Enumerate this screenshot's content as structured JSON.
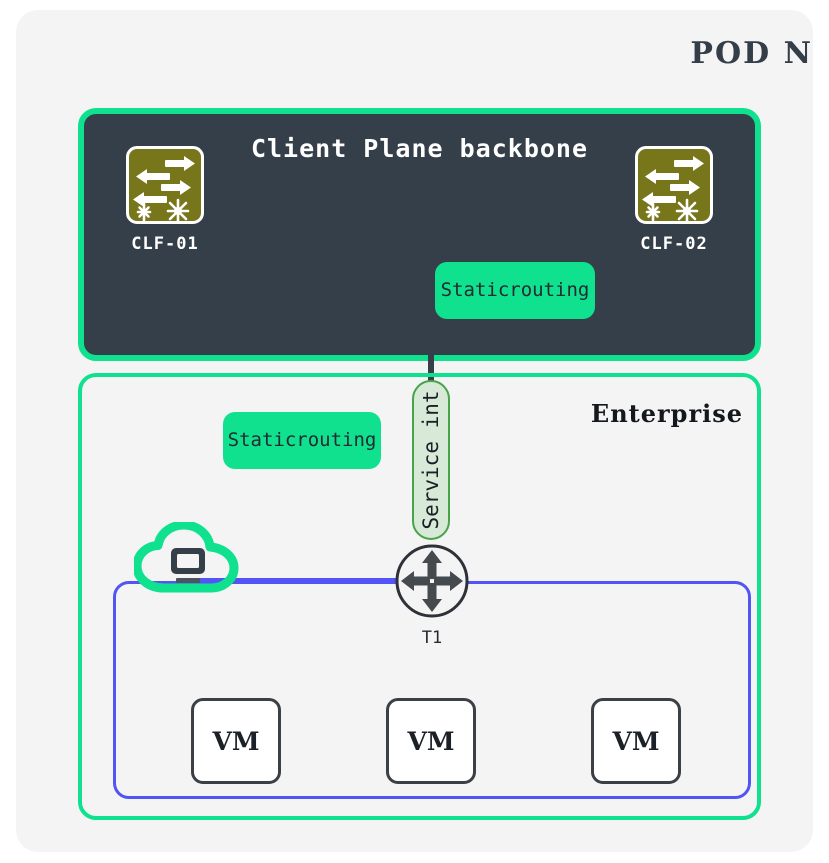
{
  "pod": {
    "title": "POD N"
  },
  "backbone": {
    "title": "Client Plane backbone",
    "switches": [
      {
        "label": "CLF-01",
        "icon": "network-switch-icon"
      },
      {
        "label": "CLF-02",
        "icon": "network-switch-icon"
      }
    ],
    "routing_badge": "Static\nrouting"
  },
  "enterprise": {
    "title": "Enterprise",
    "routing_badge": "Static\nrouting",
    "service_interface_label": "Service int",
    "cloud": {
      "icon": "cloud-with-monitor-icon"
    },
    "router": {
      "label": "T1",
      "icon": "router-icon"
    },
    "vms": [
      {
        "label": "VM"
      },
      {
        "label": "VM"
      },
      {
        "label": "VM"
      }
    ]
  },
  "colors": {
    "page_background": "#ffffff",
    "pod_background": "#f4f4f5",
    "backbone_fill": "#353f49",
    "accent_green": "#0fe18f",
    "switch_icon_fill": "#77761a",
    "service_pill_fill": "#d7ead7",
    "service_pill_border": "#49a349",
    "internal_network_blue": "#5254f5",
    "node_outline_dark": "#3b4047",
    "text_dark": "#232a31"
  }
}
